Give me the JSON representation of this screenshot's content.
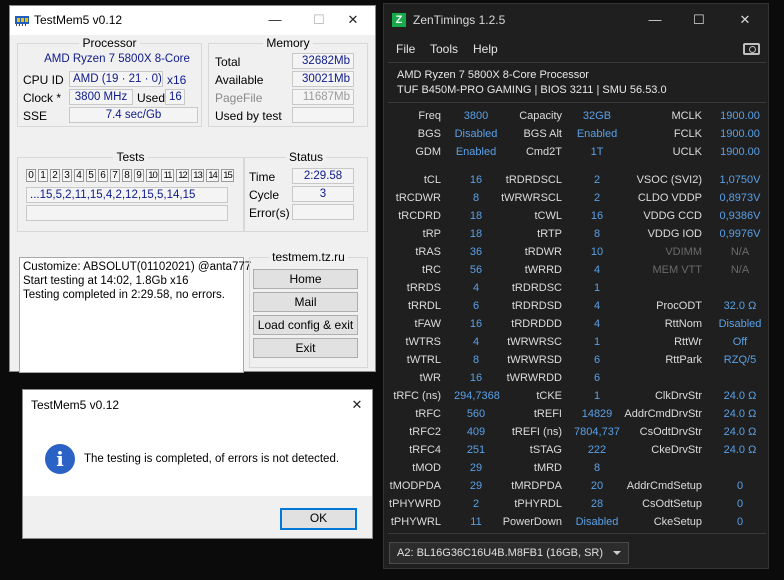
{
  "testmem": {
    "title": "TestMem5 v0.12",
    "window_controls": {
      "minimize": "—",
      "maximize": "☐",
      "close": "✕"
    },
    "processor": {
      "group": "Processor",
      "name": "AMD Ryzen 7 5800X 8-Core",
      "cpu_id_label": "CPU ID",
      "cpu_id": "AMD  (19 · 21 · 0)",
      "threads": "x16",
      "clock_label": "Clock *",
      "clock": "3800 MHz",
      "used_label": "Used",
      "used": "16",
      "sse_label": "SSE",
      "sse": "7.4 sec/Gb"
    },
    "memory": {
      "group": "Memory",
      "total_label": "Total",
      "total": "32682Mb",
      "available_label": "Available",
      "available": "30021Mb",
      "pagefile_label": "PageFile",
      "pagefile": "11687Mb",
      "used_by_test_label": "Used by test",
      "used_by_test": ""
    },
    "tests": {
      "group": "Tests",
      "numbers": [
        "0",
        "1",
        "2",
        "3",
        "4",
        "5",
        "6",
        "7",
        "8",
        "9",
        "10",
        "11",
        "12",
        "13",
        "14",
        "15"
      ],
      "sequence": "...15,5,2,11,15,4,2,12,15,5,14,15",
      "progress": ""
    },
    "status": {
      "group": "Status",
      "time_label": "Time",
      "time": "2:29.58",
      "cycle_label": "Cycle",
      "cycle": "3",
      "errors_label": "Error(s)",
      "errors": ""
    },
    "log": [
      "Customize: ABSOLUT(01102021) @anta777",
      "Start testing at 14:02, 1.8Gb x16",
      "Testing completed in 2:29.58, no errors."
    ],
    "site": {
      "group": "testmem.tz.ru",
      "buttons": [
        "Home",
        "Mail",
        "Load config & exit",
        "Exit"
      ]
    }
  },
  "dialog": {
    "title": "TestMem5 v0.12",
    "close": "✕",
    "icon": "info-icon",
    "icon_glyph": "i",
    "message": "The testing is completed, of errors is not detected.",
    "ok": "OK"
  },
  "zentimings": {
    "title": "ZenTimings 1.2.5",
    "logo": "Z",
    "window_controls": {
      "minimize": "—",
      "maximize": "☐",
      "close": "✕"
    },
    "menu": [
      "File",
      "Tools",
      "Help"
    ],
    "screenshot_icon": "camera-icon",
    "cpu": "AMD Ryzen 7 5800X 8-Core Processor",
    "board": "TUF B450M-PRO GAMING | BIOS 3211 | SMU 56.53.0",
    "top": [
      [
        "Freq",
        "3800",
        "Capacity",
        "32GB",
        "MCLK",
        "1900.00"
      ],
      [
        "BGS",
        "Disabled",
        "BGS Alt",
        "Enabled",
        "FCLK",
        "1900.00"
      ],
      [
        "GDM",
        "Enabled",
        "Cmd2T",
        "1T",
        "UCLK",
        "1900.00"
      ]
    ],
    "timings": [
      [
        "tCL",
        "16",
        "tRDRDSCL",
        "2",
        "VSOC (SVI2)",
        "1,0750V"
      ],
      [
        "tRCDWR",
        "8",
        "tWRWRSCL",
        "2",
        "CLDO VDDP",
        "0,8973V"
      ],
      [
        "tRCDRD",
        "18",
        "tCWL",
        "16",
        "VDDG CCD",
        "0,9386V"
      ],
      [
        "tRP",
        "18",
        "tRTP",
        "8",
        "VDDG IOD",
        "0,9976V"
      ],
      [
        "tRAS",
        "36",
        "tRDWR",
        "10",
        "VDIMM",
        "N/A"
      ],
      [
        "tRC",
        "56",
        "tWRRD",
        "4",
        "MEM VTT",
        "N/A"
      ],
      [
        "tRRDS",
        "4",
        "tRDRDSC",
        "1",
        "",
        ""
      ],
      [
        "tRRDL",
        "6",
        "tRDRDSD",
        "4",
        "ProcODT",
        "32.0 Ω"
      ],
      [
        "tFAW",
        "16",
        "tRDRDDD",
        "4",
        "RttNom",
        "Disabled"
      ],
      [
        "tWTRS",
        "4",
        "tWRWRSC",
        "1",
        "RttWr",
        "Off"
      ],
      [
        "tWTRL",
        "8",
        "tWRWRSD",
        "6",
        "RttPark",
        "RZQ/5"
      ],
      [
        "tWR",
        "16",
        "tWRWRDD",
        "6",
        "",
        ""
      ],
      [
        "tRFC (ns)",
        "294,7368",
        "tCKE",
        "1",
        "ClkDrvStr",
        "24.0 Ω"
      ],
      [
        "tRFC",
        "560",
        "tREFI",
        "14829",
        "AddrCmdDrvStr",
        "24.0 Ω"
      ],
      [
        "tRFC2",
        "409",
        "tREFI (ns)",
        "7804,737",
        "CsOdtDrvStr",
        "24.0 Ω"
      ],
      [
        "tRFC4",
        "251",
        "tSTAG",
        "222",
        "CkeDrvStr",
        "24.0 Ω"
      ],
      [
        "tMOD",
        "29",
        "tMRD",
        "8",
        "",
        ""
      ],
      [
        "tMODPDA",
        "29",
        "tMRDPDA",
        "20",
        "AddrCmdSetup",
        "0"
      ],
      [
        "tPHYWRD",
        "2",
        "tPHYRDL",
        "28",
        "CsOdtSetup",
        "0"
      ],
      [
        "tPHYWRL",
        "11",
        "PowerDown",
        "Disabled",
        "CkeSetup",
        "0"
      ]
    ],
    "dim_rows": [
      4,
      5
    ],
    "dimm_select": "A2: BL16G36C16U4B.M8FB1 (16GB, SR)"
  }
}
